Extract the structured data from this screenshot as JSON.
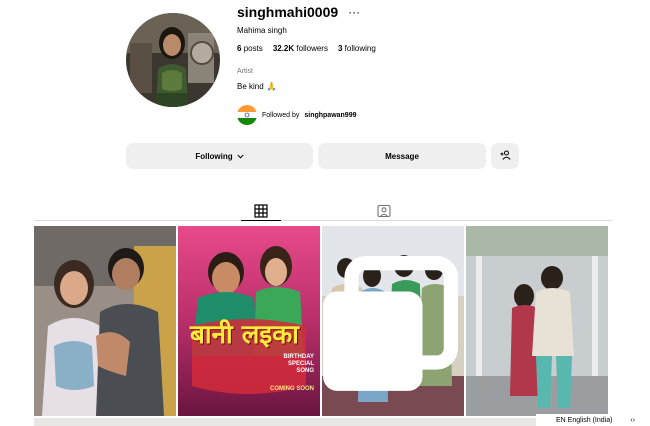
{
  "profile": {
    "username": "singhmahi0009",
    "more_label": "···",
    "full_name": "Mahima singh",
    "category": "Artist",
    "bio": "Be kind",
    "bio_emoji": "🙏",
    "stats": {
      "posts_count": "6",
      "posts_label": "posts",
      "followers_count": "32.2K",
      "followers_label": "followers",
      "following_count": "3",
      "following_label": "following"
    },
    "followed_by_prefix": "Followed by",
    "followed_by_user": "singhpawan999"
  },
  "actions": {
    "following_label": "Following",
    "message_label": "Message",
    "add_user_icon": "add-user-icon"
  },
  "tabs": [
    {
      "name": "posts",
      "icon": "grid-icon",
      "active": true
    },
    {
      "name": "tagged",
      "icon": "tagged-icon",
      "active": false
    }
  ],
  "posts": [
    {
      "id": "post-1",
      "type": "image"
    },
    {
      "id": "post-2",
      "type": "image",
      "title_text": "बानी लइका",
      "caption_text": "COMING SOON",
      "label_text": "BIRTHDAY SPECIAL SONG"
    },
    {
      "id": "post-3",
      "type": "carousel"
    },
    {
      "id": "post-4",
      "type": "image"
    }
  ],
  "footer": {
    "language": "EN English (India)",
    "arrows": "‹›"
  },
  "colors": {
    "button_bg": "#efeff0",
    "muted_text": "#737373",
    "divider": "#dbdbdb"
  }
}
